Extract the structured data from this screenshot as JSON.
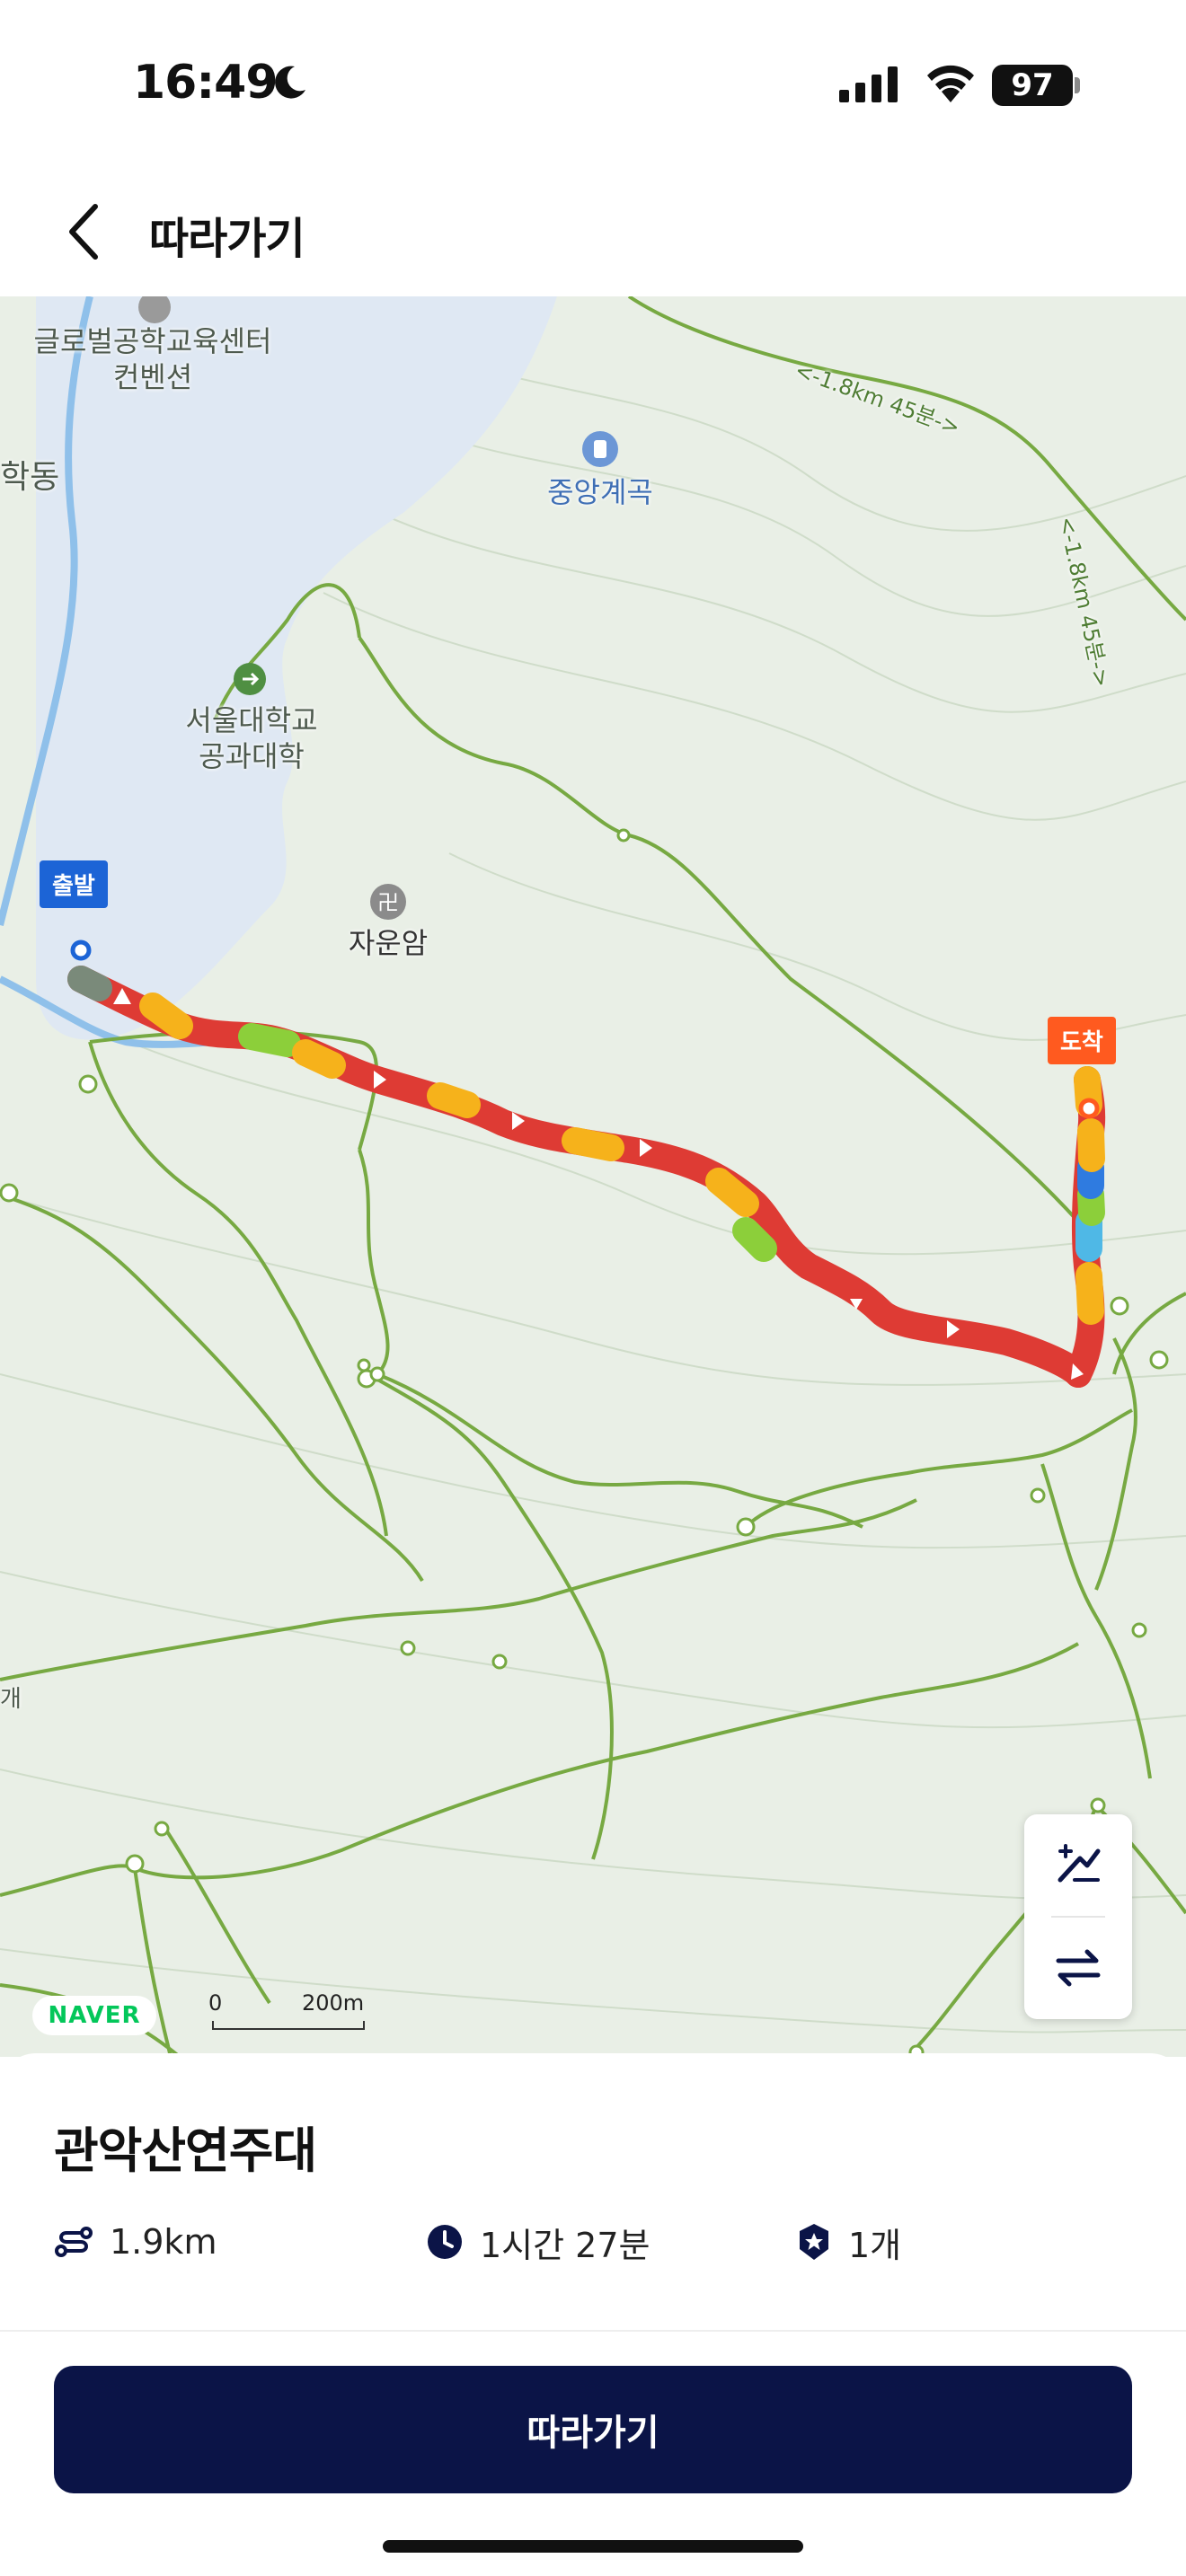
{
  "status_bar": {
    "time": "16:49",
    "battery": "97"
  },
  "header": {
    "title": "따라가기"
  },
  "map": {
    "labels": {
      "convention_line1": "글로벌공학교육센터",
      "convention_line2": "컨벤션",
      "dong_partial": "학동",
      "valley": "중앙계곡",
      "college_line1": "서울대학교",
      "college_line2": "공과대학",
      "temple": "자운암",
      "trail_distance_1": "<-1.8km 45분->",
      "trail_distance_2": "<-1.8km 45분->",
      "edge_fragment": "개"
    },
    "start_tag": "출발",
    "end_tag": "도착",
    "naver_logo": "NAVER",
    "scale": {
      "zero": "0",
      "distance": "200m"
    }
  },
  "route": {
    "name": "관악산연주대",
    "distance": "1.9km",
    "duration": "1시간 27분",
    "checkpoints": "1개"
  },
  "actions": {
    "follow_label": "따라가기"
  },
  "colors": {
    "accent_navy": "#0b1447",
    "start_blue": "#1c64d6",
    "end_orange": "#ff5a1f",
    "route_red": "#de3b34",
    "route_orange": "#f6b21b",
    "route_green": "#8ccf3a",
    "naver_green": "#03c75a"
  }
}
